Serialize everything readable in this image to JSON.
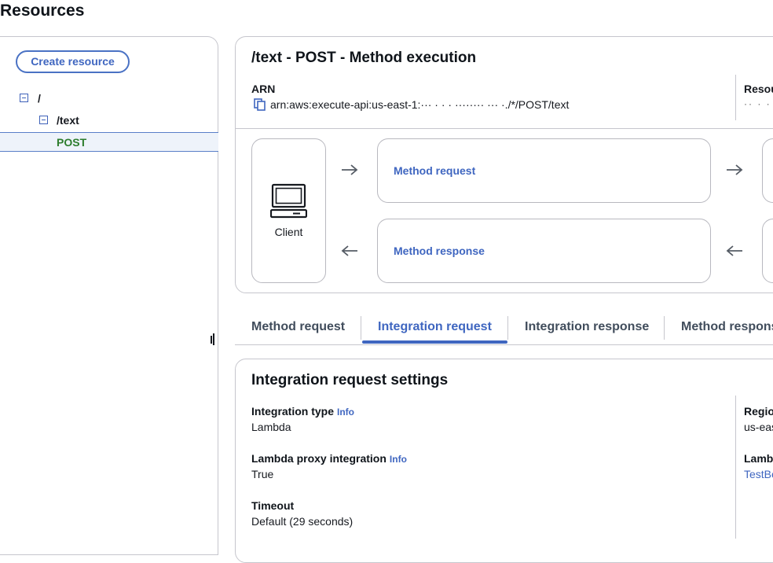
{
  "page": {
    "title": "Resources"
  },
  "sidebar": {
    "create_button": "Create resource",
    "tree": {
      "root": "/",
      "child": "/text",
      "method": "POST"
    }
  },
  "execution": {
    "title": "/text - POST - Method execution",
    "arn_label": "ARN",
    "arn_value": "arn:aws:execute-api:us-east-1:··· · · · ········ ··· ·./*/POST/text",
    "resource_id_label": "Resou",
    "resource_id_value": "·· · ·",
    "client_label": "Client",
    "method_request": "Method request",
    "method_response": "Method response"
  },
  "tabs": [
    {
      "label": "Method request"
    },
    {
      "label": "Integration request",
      "active": true
    },
    {
      "label": "Integration response"
    },
    {
      "label": "Method respons"
    }
  ],
  "settings": {
    "title": "Integration request settings",
    "info": "Info",
    "fields": {
      "integration_type": {
        "label": "Integration type",
        "value": "Lambda"
      },
      "proxy": {
        "label": "Lambda proxy integration",
        "value": "True"
      },
      "timeout": {
        "label": "Timeout",
        "value": "Default (29 seconds)"
      },
      "region": {
        "label": "Regio",
        "value": "us-eas"
      },
      "lambda": {
        "label": "Lamb",
        "value": "TestBe"
      }
    }
  },
  "colors": {
    "link": "#3f66c0",
    "selected_method": "#2d7d2d",
    "border": "#c6c6cd"
  }
}
